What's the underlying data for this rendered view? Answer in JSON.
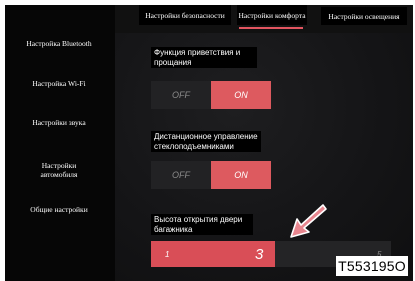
{
  "sidebar": {
    "items": [
      {
        "label": "Настройка Bluetooth"
      },
      {
        "label": "Настройка Wi-Fi"
      },
      {
        "label": "Настройки звука"
      },
      {
        "label": "Настройки автомобиля"
      },
      {
        "label": "Общие настройки"
      }
    ]
  },
  "tabs": [
    {
      "label": "Настройки безопасности"
    },
    {
      "label": "Настройки комфорта",
      "active": true
    },
    {
      "label": "Настройки освещения"
    }
  ],
  "settings": {
    "greeting": {
      "label": "Функция приветствия и прощания",
      "off": "OFF",
      "on": "ON",
      "value": "ON"
    },
    "windows": {
      "label": "Дистанционное управление стеклоподъемниками",
      "off": "OFF",
      "on": "ON",
      "value": "ON"
    },
    "trunk": {
      "label": "Высота открытия двери багажника",
      "min": "1",
      "max": "5",
      "value": "3"
    }
  },
  "figure_code": "T553195O",
  "colors": {
    "accent": "#dd5a5f",
    "arrow": "#e8868f"
  }
}
